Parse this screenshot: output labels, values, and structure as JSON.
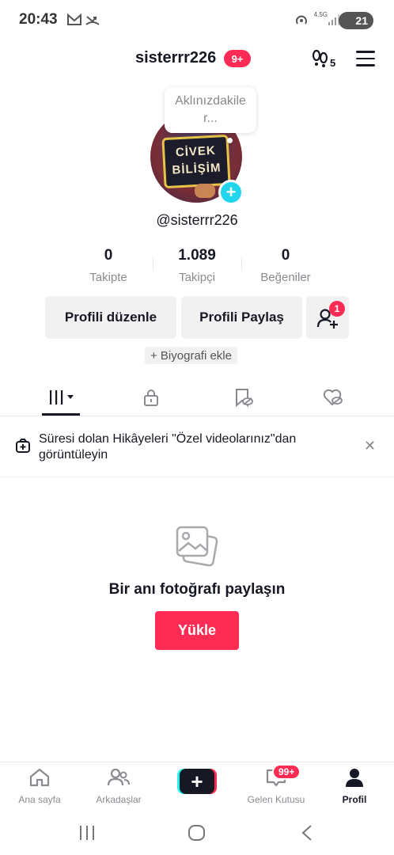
{
  "status_bar": {
    "time": "20:43",
    "network": "4.5G",
    "battery": "21"
  },
  "header": {
    "username": "sisterrr226",
    "notification_badge": "9+",
    "footprint_count": "5"
  },
  "profile": {
    "note_text": "Aklınızdakiler...",
    "avatar_text_line1": "CİVEK",
    "avatar_text_line2": "BİLİŞİM",
    "handle": "@sisterrr226"
  },
  "stats": [
    {
      "value": "0",
      "label": "Takipte"
    },
    {
      "value": "1.089",
      "label": "Takipçi"
    },
    {
      "value": "0",
      "label": "Beğeniler"
    }
  ],
  "actions": {
    "edit_profile": "Profili düzenle",
    "share_profile": "Profili Paylaş",
    "add_friend_badge": "1",
    "add_bio": "+ Biyografi ekle"
  },
  "notice": {
    "text": "Süresi dolan Hikâyeleri \"Özel videolarınız\"dan görüntüleyin"
  },
  "empty_state": {
    "title": "Bir anı fotoğrafı paylaşın",
    "upload_button": "Yükle"
  },
  "bottom_nav": {
    "home": "Ana sayfa",
    "friends": "Arkadaşlar",
    "inbox": "Gelen Kutusu",
    "inbox_badge": "99+",
    "profile": "Profil"
  },
  "colors": {
    "accent": "#fe2c55",
    "cyan": "#20d5ec",
    "text": "#161823",
    "muted": "#8a8b91"
  }
}
